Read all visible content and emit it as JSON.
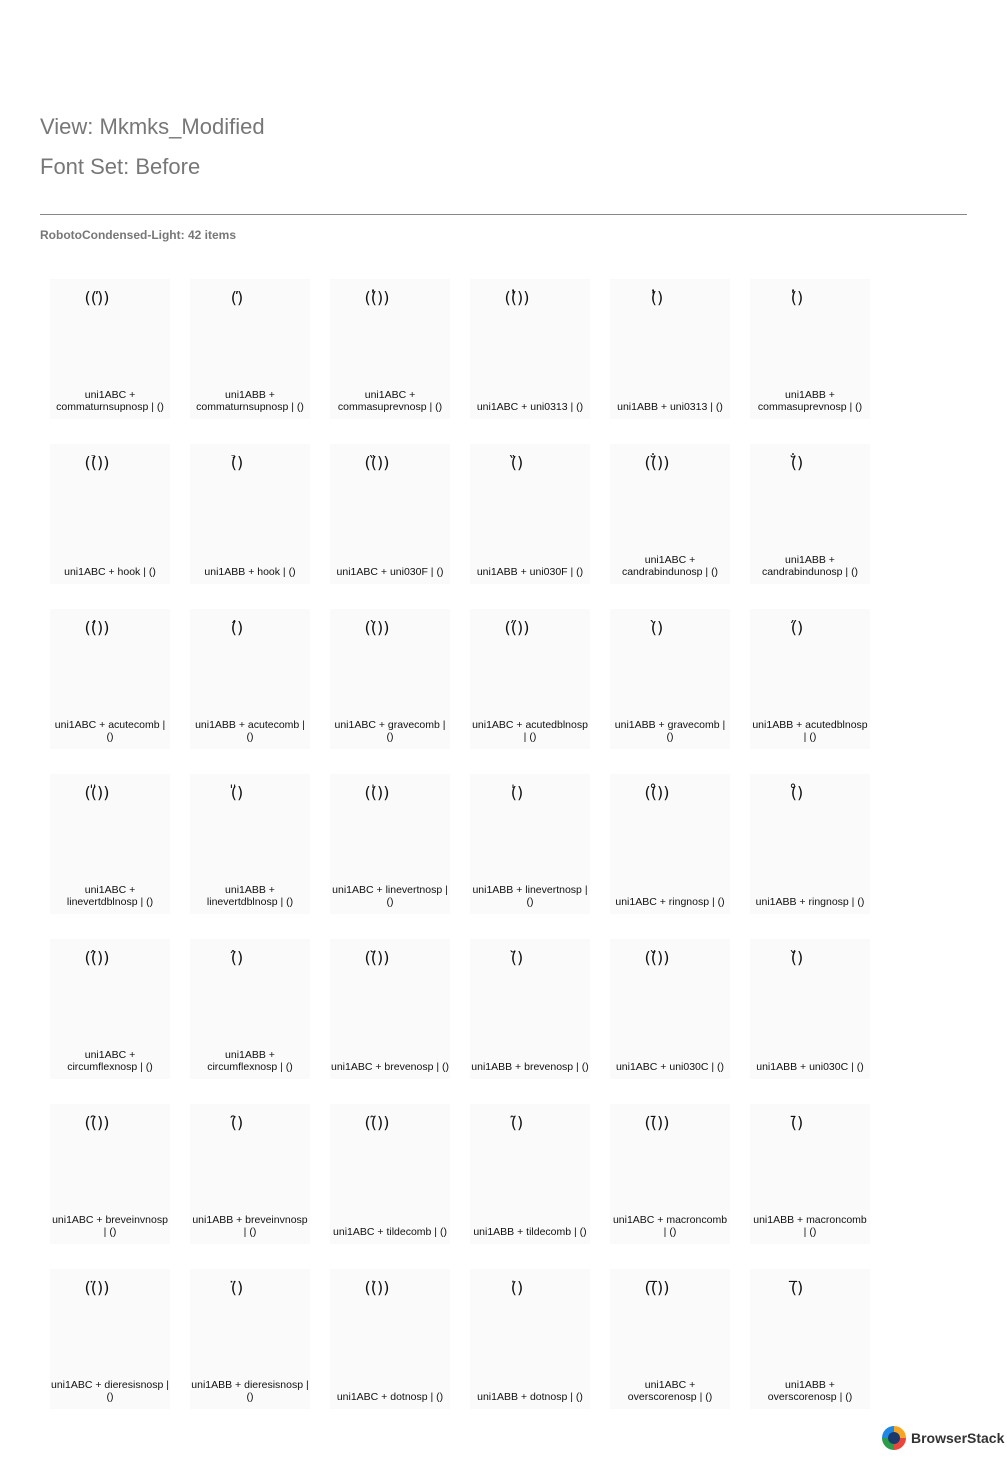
{
  "header": {
    "view_line": "View: Mkmks_Modified",
    "fontset_line": "Font Set: Before"
  },
  "section": {
    "summary": "RobotoCondensed-Light: 42 items"
  },
  "items": [
    {
      "glyph": "((̕))",
      "label": "uni1ABC + commaturnsupnosp | ()"
    },
    {
      "glyph": "(̕)",
      "label": "uni1ABB + commaturnsupnosp | ()"
    },
    {
      "glyph": "((̔))",
      "label": "uni1ABC + commasuprevnosp | ()"
    },
    {
      "glyph": "((̓))",
      "label": "uni1ABC + uni0313 | ()"
    },
    {
      "glyph": "(̓)",
      "label": "uni1ABB + uni0313 | ()"
    },
    {
      "glyph": "(̔)",
      "label": "uni1ABB + commasuprevnosp | ()"
    },
    {
      "glyph": "((̉))",
      "label": "uni1ABC + hook | ()"
    },
    {
      "glyph": "(̉)",
      "label": "uni1ABB + hook | ()"
    },
    {
      "glyph": "((̏))",
      "label": "uni1ABC + uni030F | ()"
    },
    {
      "glyph": "(̏)",
      "label": "uni1ABB + uni030F | ()"
    },
    {
      "glyph": "((̐))",
      "label": "uni1ABC + candrabindunosp | ()"
    },
    {
      "glyph": "(̐)",
      "label": "uni1ABB + candrabindunosp | ()"
    },
    {
      "glyph": "((́))",
      "label": "uni1ABC + acutecomb | ()"
    },
    {
      "glyph": "(́)",
      "label": "uni1ABB + acutecomb | ()"
    },
    {
      "glyph": "((̀))",
      "label": "uni1ABC + gravecomb | ()"
    },
    {
      "glyph": "((̋))",
      "label": "uni1ABC + acutedblnosp | ()"
    },
    {
      "glyph": "(̀)",
      "label": "uni1ABB + gravecomb | ()"
    },
    {
      "glyph": "(̋)",
      "label": "uni1ABB + acutedblnosp | ()"
    },
    {
      "glyph": "((̎))",
      "label": "uni1ABC + linevertdblnosp | ()"
    },
    {
      "glyph": "(̎)",
      "label": "uni1ABB + linevertdblnosp | ()"
    },
    {
      "glyph": "((̍))",
      "label": "uni1ABC + linevertnosp | ()"
    },
    {
      "glyph": "(̍)",
      "label": "uni1ABB + linevertnosp | ()"
    },
    {
      "glyph": "((̊))",
      "label": "uni1ABC + ringnosp | ()"
    },
    {
      "glyph": "(̊)",
      "label": "uni1ABB + ringnosp | ()"
    },
    {
      "glyph": "((̂))",
      "label": "uni1ABC + circumflexnosp | ()"
    },
    {
      "glyph": "(̂)",
      "label": "uni1ABB + circumflexnosp | ()"
    },
    {
      "glyph": "((̆))",
      "label": "uni1ABC + brevenosp | ()"
    },
    {
      "glyph": "(̆)",
      "label": "uni1ABB + brevenosp | ()"
    },
    {
      "glyph": "((̌))",
      "label": "uni1ABC + uni030C | ()"
    },
    {
      "glyph": "(̌)",
      "label": "uni1ABB + uni030C | ()"
    },
    {
      "glyph": "((̑))",
      "label": "uni1ABC + breveinvnosp | ()"
    },
    {
      "glyph": "(̑)",
      "label": "uni1ABB + breveinvnosp | ()"
    },
    {
      "glyph": "((̃))",
      "label": "uni1ABC + tildecomb | ()"
    },
    {
      "glyph": "(̃)",
      "label": "uni1ABB + tildecomb | ()"
    },
    {
      "glyph": "((̄))",
      "label": "uni1ABC + macroncomb | ()"
    },
    {
      "glyph": "(̄)",
      "label": "uni1ABB + macroncomb | ()"
    },
    {
      "glyph": "((̈))",
      "label": "uni1ABC + dieresisnosp | ()"
    },
    {
      "glyph": "(̈)",
      "label": "uni1ABB + dieresisnosp | ()"
    },
    {
      "glyph": "((̇))",
      "label": "uni1ABC + dotnosp | ()"
    },
    {
      "glyph": "(̇)",
      "label": "uni1ABB + dotnosp | ()"
    },
    {
      "glyph": "((̅))",
      "label": "uni1ABC + overscorenosp | ()"
    },
    {
      "glyph": "(̅)",
      "label": "uni1ABB + overscorenosp | ()"
    }
  ],
  "footer": {
    "brand_name": "BrowserStack",
    "brand_icon": "browserstack-logo-icon"
  }
}
